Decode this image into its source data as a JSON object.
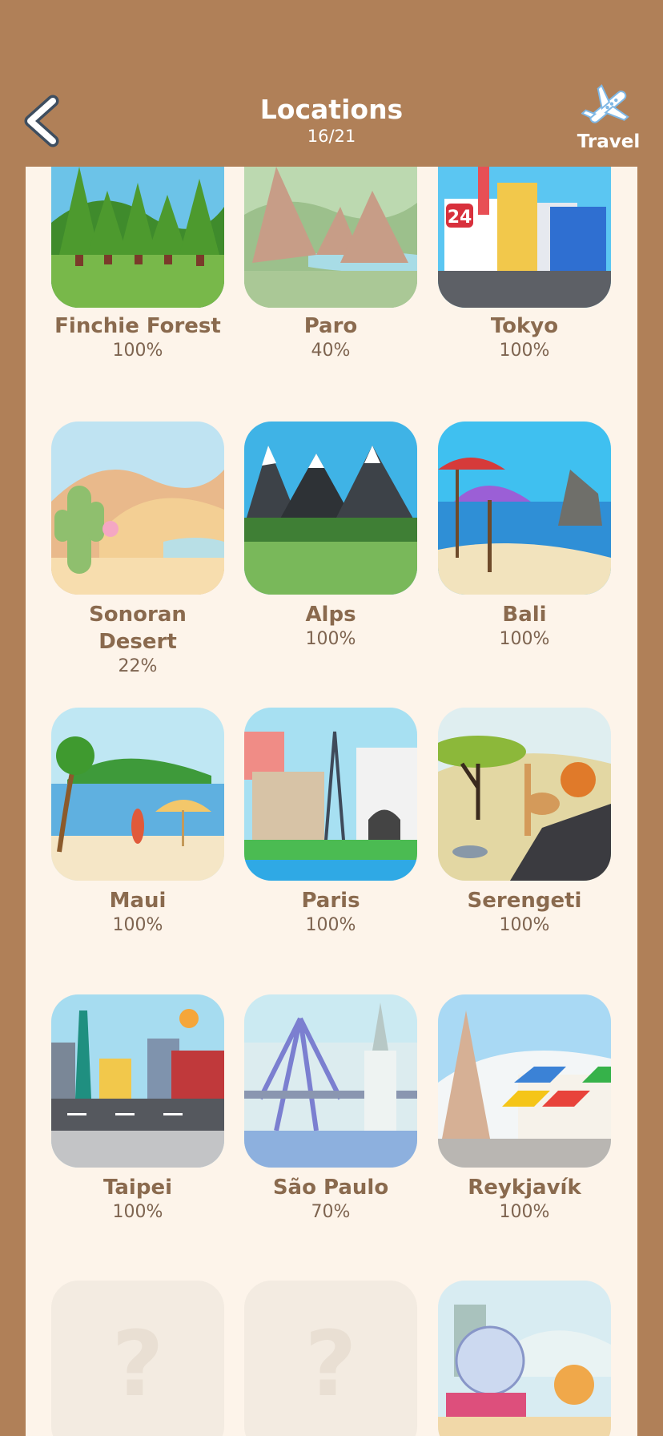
{
  "header": {
    "title": "Locations",
    "progress": "16/21",
    "travel_label": "Travel"
  },
  "icons": {
    "back": "chevron-left-icon",
    "travel": "airplane-icon"
  },
  "locations": [
    {
      "name": "Finchie Forest",
      "percent": "100%"
    },
    {
      "name": "Paro",
      "percent": "40%"
    },
    {
      "name": "Tokyo",
      "percent": "100%"
    },
    {
      "name": "Sonoran Desert",
      "percent": "22%"
    },
    {
      "name": "Alps",
      "percent": "100%"
    },
    {
      "name": "Bali",
      "percent": "100%"
    },
    {
      "name": "Maui",
      "percent": "100%"
    },
    {
      "name": "Paris",
      "percent": "100%"
    },
    {
      "name": "Serengeti",
      "percent": "100%"
    },
    {
      "name": "Taipei",
      "percent": "100%"
    },
    {
      "name": "São Paulo",
      "percent": "70%"
    },
    {
      "name": "Reykjavík",
      "percent": "100%"
    }
  ],
  "locked_tiles": [
    {
      "symbol": "?"
    },
    {
      "symbol": "?"
    }
  ],
  "colors": {
    "background": "#b08058",
    "panel": "#fdf4ea",
    "label": "#8a6a4e"
  }
}
